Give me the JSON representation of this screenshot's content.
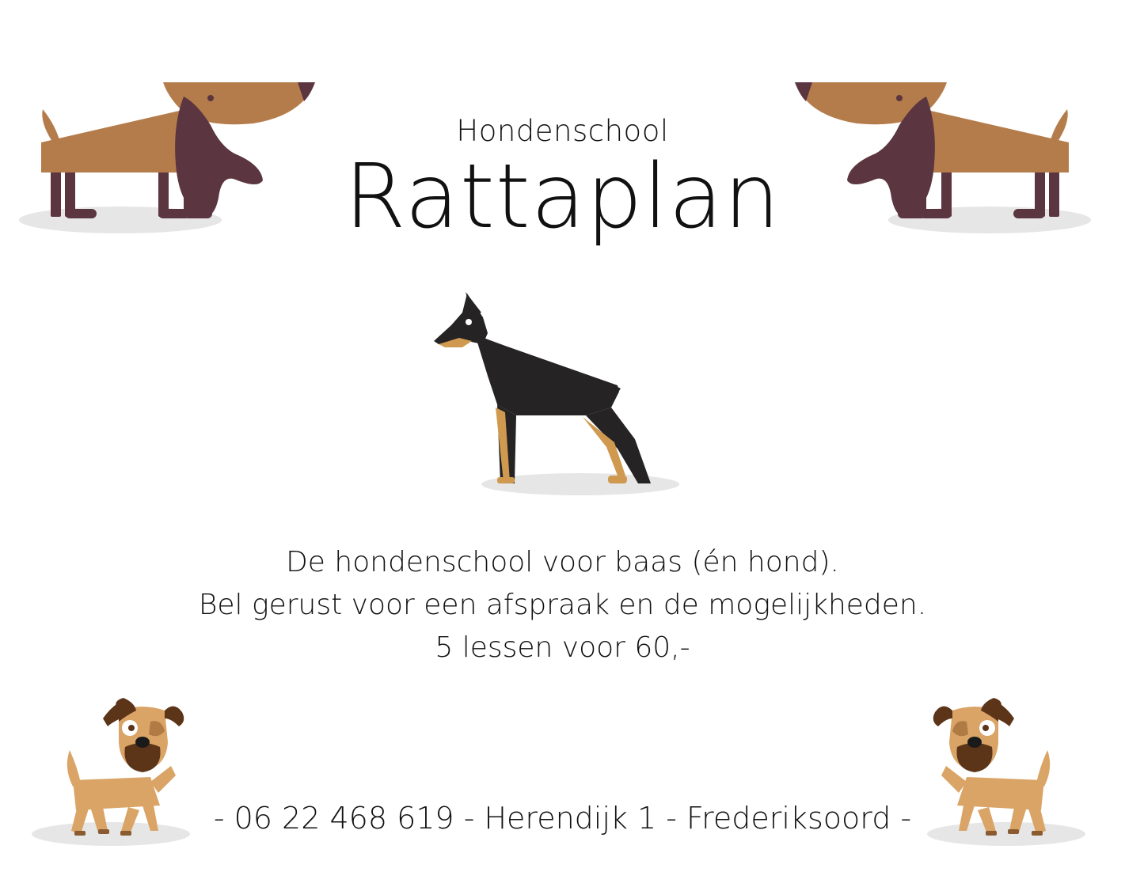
{
  "header": {
    "subtitle": "Hondenschool",
    "title": "Rattaplan"
  },
  "body": {
    "lines": [
      "De hondenschool voor baas (én hond).",
      "Bel gerust voor een afspraak en de mogelijkheden.",
      "5 lessen voor 60,-"
    ]
  },
  "footer": {
    "contact": "- 06 22 468 619 - Herendijk 1 - Frederiksoord -"
  },
  "colors": {
    "dachshund_body": "#b57c4b",
    "dachshund_ear": "#5b3540",
    "doberman_body": "#262324",
    "doberman_tan": "#cf9a4f",
    "puppy_body": "#d9a466",
    "puppy_dark": "#5c3418",
    "shadow": "#e6e6e6"
  },
  "illustrations": {
    "top_left": "dachshund-icon",
    "top_right": "dachshund-icon",
    "center": "doberman-icon",
    "bottom_left": "puppy-icon",
    "bottom_right": "puppy-icon"
  }
}
